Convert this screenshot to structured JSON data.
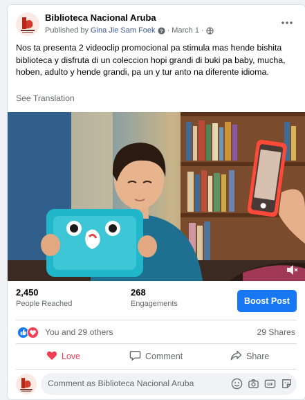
{
  "post": {
    "page_name": "Biblioteca Nacional Aruba",
    "published_by_label": "Published by",
    "author": "Gina Jie Sam Foek",
    "date": "March 1",
    "text": "Nos ta presenta 2 videoclip promocional pa stimula mas hende bishita biblioteca y disfruta di un coleccion hopi grandi di buki pa baby, mucha, hoben, adulto y hende grandi, pa un y tur anto na diferente idioma.",
    "see_translation": "See Translation"
  },
  "stats": {
    "people_reached": "2,450",
    "people_reached_label": "People Reached",
    "engagements": "268",
    "engagements_label": "Engagements",
    "boost_label": "Boost Post"
  },
  "reactions": {
    "summary": "You and 29 others",
    "shares": "29 Shares"
  },
  "actions": {
    "love": "Love",
    "comment": "Comment",
    "share": "Share"
  },
  "composer": {
    "placeholder": "Comment as Biblioteca Nacional Aruba"
  },
  "colors": {
    "brand_blue": "#1877f2",
    "love_red": "#f33e58",
    "like_blue": "#1877f2",
    "muted": "#65676b"
  },
  "icons": {
    "more": "more-dots-icon",
    "visibility": "globe-icon",
    "verified": "verified-icon",
    "mute": "volume-muted-icon",
    "like_reaction": "like-reaction-icon",
    "love_reaction": "love-reaction-icon",
    "love_action": "love-icon",
    "comment_action": "comment-icon",
    "share_action": "share-icon",
    "emoji": "emoji-icon",
    "camera": "camera-icon",
    "gif": "gif-icon",
    "sticker": "sticker-icon"
  }
}
